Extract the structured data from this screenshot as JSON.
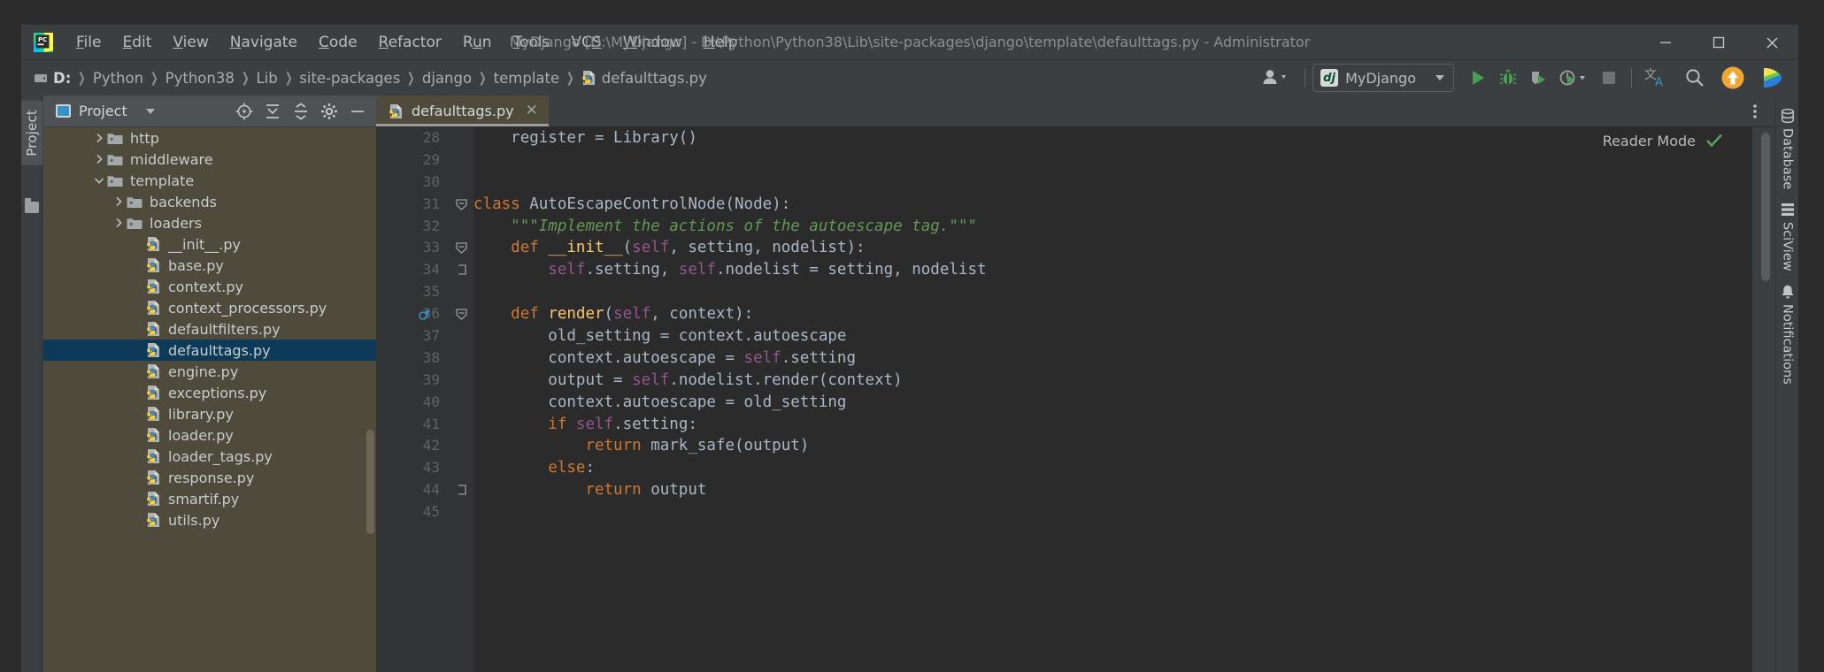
{
  "window": {
    "title": "MyDjango [D:\\MyDjango] - D:\\Python\\Python38\\Lib\\site-packages\\django\\template\\defaulttags.py - Administrator",
    "logo_icon": "pycharm-logo-icon",
    "minimize_label": "–",
    "maximize_label": "□",
    "close_label": "✕"
  },
  "menubar": {
    "items": [
      {
        "label": "File",
        "mnemonic": "F"
      },
      {
        "label": "Edit",
        "mnemonic": "E"
      },
      {
        "label": "View",
        "mnemonic": "V"
      },
      {
        "label": "Navigate",
        "mnemonic": "N"
      },
      {
        "label": "Code",
        "mnemonic": "C"
      },
      {
        "label": "Refactor",
        "mnemonic": "R"
      },
      {
        "label": "Run",
        "mnemonic": "u"
      },
      {
        "label": "Tools",
        "mnemonic": "T"
      },
      {
        "label": "VCS",
        "mnemonic": "S"
      },
      {
        "label": "Window",
        "mnemonic": "W"
      },
      {
        "label": "Help",
        "mnemonic": "H"
      }
    ]
  },
  "navbar": {
    "breadcrumbs": [
      {
        "label": "D:",
        "icon": "drive-icon"
      },
      {
        "label": "Python",
        "icon": ""
      },
      {
        "label": "Python38",
        "icon": ""
      },
      {
        "label": "Lib",
        "icon": ""
      },
      {
        "label": "site-packages",
        "icon": ""
      },
      {
        "label": "django",
        "icon": ""
      },
      {
        "label": "template",
        "icon": ""
      },
      {
        "label": "defaulttags.py",
        "icon": "python-file-icon"
      }
    ],
    "separator": "›",
    "right_controls": {
      "user_icon": "user-account-icon",
      "run_config": {
        "label": "MyDjango",
        "icon": "django-icon",
        "badge": "dj"
      },
      "run_button": "run-icon",
      "debug_button": "debug-icon",
      "coverage_button": "run-with-coverage-icon",
      "profile_button": "profile-icon",
      "stop_button": "stop-icon",
      "translate_button": "translate-icon",
      "search_button": "search-everywhere-icon",
      "update_button": "update-project-icon",
      "plugin_button": "plugin-icon"
    }
  },
  "left_strip": {
    "tabs": [
      {
        "label": "Project",
        "active": true
      }
    ],
    "bottom_icon": "structure-folder-icon"
  },
  "right_strip": {
    "tabs": [
      {
        "label": "Database",
        "icon": "database-icon"
      },
      {
        "label": "SciView",
        "icon": "sciview-icon"
      },
      {
        "label": "Notifications",
        "icon": "notifications-icon"
      }
    ]
  },
  "project_panel": {
    "title": "Project",
    "dropdown_icon": "chevron-down-icon",
    "header_icons": [
      {
        "name": "select-opened-file-icon"
      },
      {
        "name": "expand-all-icon"
      },
      {
        "name": "collapse-all-icon"
      },
      {
        "name": "settings-gear-icon"
      },
      {
        "name": "hide-panel-icon"
      }
    ],
    "tree": [
      {
        "label": "http",
        "type": "folder",
        "indent": 2,
        "expanded": false,
        "selected": false
      },
      {
        "label": "middleware",
        "type": "folder",
        "indent": 2,
        "expanded": false,
        "selected": false
      },
      {
        "label": "template",
        "type": "folder",
        "indent": 2,
        "expanded": true,
        "selected": false
      },
      {
        "label": "backends",
        "type": "folder",
        "indent": 3,
        "expanded": false,
        "selected": false
      },
      {
        "label": "loaders",
        "type": "folder",
        "indent": 3,
        "expanded": false,
        "selected": false
      },
      {
        "label": "__init__.py",
        "type": "python",
        "indent": 4,
        "expanded": null,
        "selected": false
      },
      {
        "label": "base.py",
        "type": "python",
        "indent": 4,
        "expanded": null,
        "selected": false
      },
      {
        "label": "context.py",
        "type": "python",
        "indent": 4,
        "expanded": null,
        "selected": false
      },
      {
        "label": "context_processors.py",
        "type": "python",
        "indent": 4,
        "expanded": null,
        "selected": false
      },
      {
        "label": "defaultfilters.py",
        "type": "python",
        "indent": 4,
        "expanded": null,
        "selected": false
      },
      {
        "label": "defaulttags.py",
        "type": "python",
        "indent": 4,
        "expanded": null,
        "selected": true
      },
      {
        "label": "engine.py",
        "type": "python",
        "indent": 4,
        "expanded": null,
        "selected": false
      },
      {
        "label": "exceptions.py",
        "type": "python",
        "indent": 4,
        "expanded": null,
        "selected": false
      },
      {
        "label": "library.py",
        "type": "python",
        "indent": 4,
        "expanded": null,
        "selected": false
      },
      {
        "label": "loader.py",
        "type": "python",
        "indent": 4,
        "expanded": null,
        "selected": false
      },
      {
        "label": "loader_tags.py",
        "type": "python",
        "indent": 4,
        "expanded": null,
        "selected": false
      },
      {
        "label": "response.py",
        "type": "python",
        "indent": 4,
        "expanded": null,
        "selected": false
      },
      {
        "label": "smartif.py",
        "type": "python",
        "indent": 4,
        "expanded": null,
        "selected": false
      },
      {
        "label": "utils.py",
        "type": "python",
        "indent": 4,
        "expanded": null,
        "selected": false
      }
    ]
  },
  "editor": {
    "tabs": [
      {
        "label": "defaulttags.py",
        "icon": "python-file-icon",
        "active": true,
        "close_label": "✕"
      }
    ],
    "more_icon": "more-vertical-icon",
    "reader_mode": {
      "label": "Reader Mode",
      "status_icon": "green-check-icon"
    },
    "first_line_number": 28,
    "lines": [
      {
        "n": 28,
        "indent": 1,
        "fold": "",
        "gutter": "",
        "tokens": [
          {
            "t": "register = Library()",
            "c": "plain"
          }
        ]
      },
      {
        "n": 29,
        "indent": 0,
        "fold": "",
        "gutter": "",
        "tokens": []
      },
      {
        "n": 30,
        "indent": 0,
        "fold": "",
        "gutter": "",
        "tokens": []
      },
      {
        "n": 31,
        "indent": 0,
        "fold": "minus",
        "gutter": "",
        "tokens": [
          {
            "t": "class ",
            "c": "kw"
          },
          {
            "t": "AutoEscapeControlNode",
            "c": "plain"
          },
          {
            "t": "(Node):",
            "c": "plain"
          }
        ]
      },
      {
        "n": 32,
        "indent": 1,
        "fold": "",
        "gutter": "",
        "tokens": [
          {
            "t": "\"\"\"Implement the actions of the autoescape tag.\"\"\"",
            "c": "docs"
          }
        ]
      },
      {
        "n": 33,
        "indent": 1,
        "fold": "minus",
        "gutter": "",
        "tokens": [
          {
            "t": "def ",
            "c": "kw"
          },
          {
            "t": "__init__",
            "c": "fn"
          },
          {
            "t": "(",
            "c": "plain"
          },
          {
            "t": "self",
            "c": "slf"
          },
          {
            "t": ", setting, nodelist):",
            "c": "plain"
          }
        ]
      },
      {
        "n": 34,
        "indent": 2,
        "fold": "end",
        "gutter": "",
        "tokens": [
          {
            "t": "self",
            "c": "slf"
          },
          {
            "t": ".setting, ",
            "c": "plain"
          },
          {
            "t": "self",
            "c": "slf"
          },
          {
            "t": ".nodelist = setting, nodelist",
            "c": "plain"
          }
        ]
      },
      {
        "n": 35,
        "indent": 0,
        "fold": "",
        "gutter": "",
        "tokens": []
      },
      {
        "n": 36,
        "indent": 1,
        "fold": "minus",
        "gutter": "override",
        "tokens": [
          {
            "t": "def ",
            "c": "kw"
          },
          {
            "t": "render",
            "c": "fn"
          },
          {
            "t": "(",
            "c": "plain"
          },
          {
            "t": "self",
            "c": "slf"
          },
          {
            "t": ", context):",
            "c": "plain"
          }
        ]
      },
      {
        "n": 37,
        "indent": 2,
        "fold": "",
        "gutter": "",
        "tokens": [
          {
            "t": "old_setting = context.autoescape",
            "c": "plain"
          }
        ]
      },
      {
        "n": 38,
        "indent": 2,
        "fold": "",
        "gutter": "",
        "tokens": [
          {
            "t": "context.autoescape = ",
            "c": "plain"
          },
          {
            "t": "self",
            "c": "slf"
          },
          {
            "t": ".setting",
            "c": "plain"
          }
        ]
      },
      {
        "n": 39,
        "indent": 2,
        "fold": "",
        "gutter": "",
        "tokens": [
          {
            "t": "output = ",
            "c": "plain"
          },
          {
            "t": "self",
            "c": "slf"
          },
          {
            "t": ".nodelist.render(context)",
            "c": "plain"
          }
        ]
      },
      {
        "n": 40,
        "indent": 2,
        "fold": "",
        "gutter": "",
        "tokens": [
          {
            "t": "context.autoescape = old_setting",
            "c": "plain"
          }
        ]
      },
      {
        "n": 41,
        "indent": 2,
        "fold": "",
        "gutter": "",
        "tokens": [
          {
            "t": "if ",
            "c": "kw"
          },
          {
            "t": "self",
            "c": "slf"
          },
          {
            "t": ".setting:",
            "c": "plain"
          }
        ]
      },
      {
        "n": 42,
        "indent": 3,
        "fold": "",
        "gutter": "",
        "tokens": [
          {
            "t": "return ",
            "c": "kw"
          },
          {
            "t": "mark_safe(output)",
            "c": "plain"
          }
        ]
      },
      {
        "n": 43,
        "indent": 2,
        "fold": "",
        "gutter": "",
        "tokens": [
          {
            "t": "else",
            "c": "kw"
          },
          {
            "t": ":",
            "c": "plain"
          }
        ]
      },
      {
        "n": 44,
        "indent": 3,
        "fold": "end",
        "gutter": "",
        "tokens": [
          {
            "t": "return ",
            "c": "kw"
          },
          {
            "t": "output",
            "c": "plain"
          }
        ]
      },
      {
        "n": 45,
        "indent": 0,
        "fold": "",
        "gutter": "",
        "tokens": []
      }
    ]
  },
  "colors": {
    "titlebar_bg": "#3c3f41",
    "editor_bg": "#2b2b2b",
    "gutter_bg": "#313335",
    "project_bg": "#4e4b3d",
    "selection_blue": "#0d3a58",
    "accent_green": "#499c54",
    "accent_orange": "#e8a33d",
    "keyword_orange": "#cc7832",
    "string_green": "#6a8759",
    "doc_green": "#629755",
    "function_yellow": "#ffc66d",
    "self_purple": "#94558d",
    "text_gray": "#a9b7c6"
  }
}
